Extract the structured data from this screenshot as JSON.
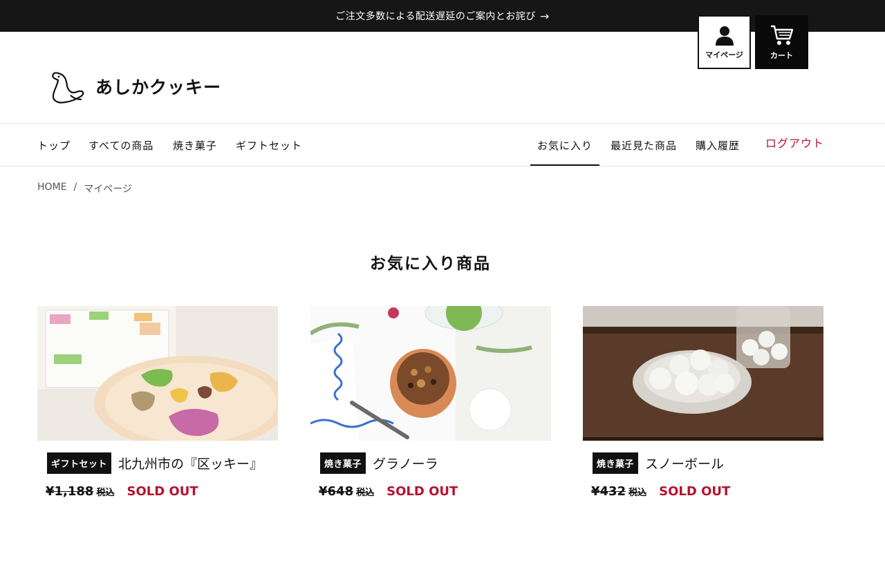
{
  "announcement": {
    "text": "ご注文多数による配送遅延のご案内とお詫び",
    "arrow_icon": "arrow-right-icon"
  },
  "brand": {
    "name": "あしかクッキー",
    "logo_icon": "sea-lion-icon"
  },
  "header_buttons": {
    "mypage_label": "マイページ",
    "cart_label": "カート"
  },
  "nav": {
    "left": [
      "トップ",
      "すべての商品",
      "焼き菓子",
      "ギフトセット"
    ],
    "right": [
      "お気に入り",
      "最近見た商品",
      "購入履歴"
    ],
    "logout": "ログアウト",
    "active": "お気に入り"
  },
  "breadcrumb": {
    "home": "HOME",
    "separator": "/",
    "current": "マイページ"
  },
  "page_title": "お気に入り商品",
  "products": [
    {
      "category": "ギフトセット",
      "name": "北九州市の『区ッキー』",
      "price": "¥1,188",
      "tax": "税込",
      "status": "SOLD OUT"
    },
    {
      "category": "焼き菓子",
      "name": "グラノーラ",
      "price": "¥648",
      "tax": "税込",
      "status": "SOLD OUT"
    },
    {
      "category": "焼き菓子",
      "name": "スノーボール",
      "price": "¥432",
      "tax": "税込",
      "status": "SOLD OUT"
    }
  ],
  "colors": {
    "accent": "#b5122d",
    "dark": "#161616"
  }
}
